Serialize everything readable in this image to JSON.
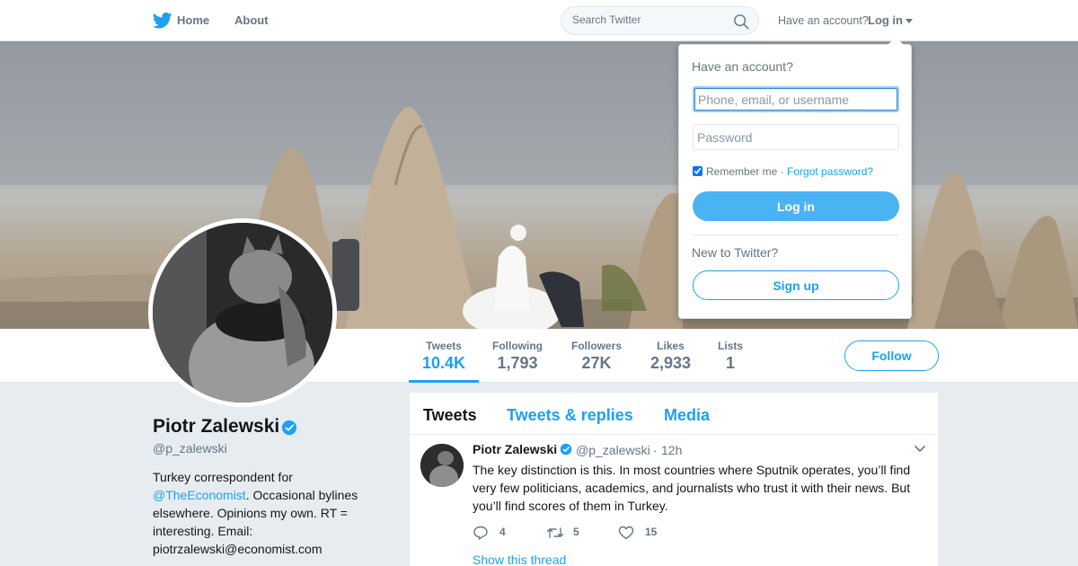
{
  "nav": {
    "home_label": "Home",
    "about_label": "About",
    "search_placeholder": "Search Twitter",
    "have_account_text": "Have an account?",
    "login_label": "Log in"
  },
  "profile": {
    "name": "Piotr Zalewski",
    "handle": "@p_zalewski",
    "bio_prefix": "Turkey correspondent for",
    "bio_mention": "@TheEconomist",
    "bio_suffix": ". Occasional bylines elsewhere. Opinions my own. RT = interesting. Email: piotrzalewski@economist.com",
    "follow_label": "Follow"
  },
  "stats": [
    {
      "label": "Tweets",
      "value": "10.4K"
    },
    {
      "label": "Following",
      "value": "1,793"
    },
    {
      "label": "Followers",
      "value": "27K"
    },
    {
      "label": "Likes",
      "value": "2,933"
    },
    {
      "label": "Lists",
      "value": "1"
    }
  ],
  "timeline": {
    "tabs": [
      "Tweets",
      "Tweets & replies",
      "Media"
    ],
    "tweet": {
      "name": "Piotr Zalewski",
      "handle": "@p_zalewski",
      "separator": "·",
      "time": "12h",
      "text": "The key distinction is this. In most countries where Sputnik operates, you’ll find very few politicians, academics, and journalists who trust it with their news. But you’ll find scores of them in Turkey.",
      "replies": "4",
      "retweets": "5",
      "likes": "15",
      "show_thread": "Show this thread"
    }
  },
  "login_dropdown": {
    "title": "Have an account?",
    "username_placeholder": "Phone, email, or username",
    "password_placeholder": "Password",
    "remember_label": "Remember me ·",
    "forgot_label": "Forgot password?",
    "login_button": "Log in",
    "new_text": "New to Twitter?",
    "signup_button": "Sign up"
  },
  "colors": {
    "accent": "#1da1f2",
    "login_button": "#4ab3f4",
    "page_background": "#e6ecf0",
    "secondary_text": "#657786"
  },
  "icons": [
    "twitter-bird-icon",
    "search-icon",
    "caret-down-icon",
    "verified-badge-icon",
    "reply-icon",
    "retweet-icon",
    "like-heart-icon",
    "chevron-down-icon"
  ]
}
